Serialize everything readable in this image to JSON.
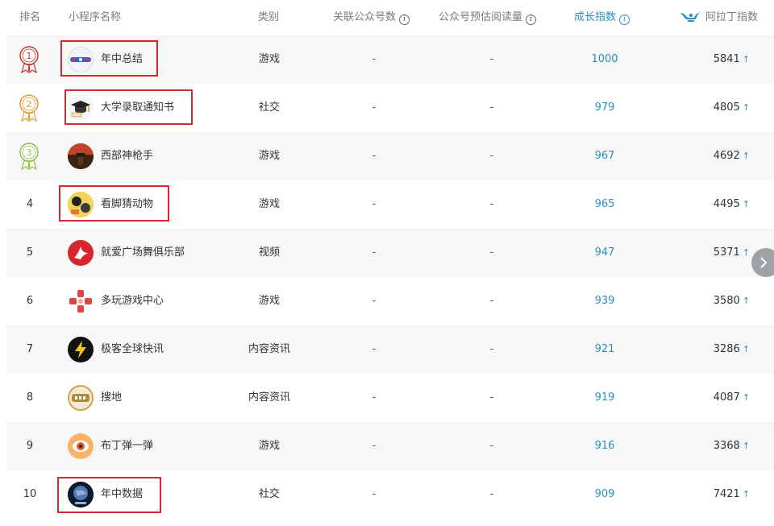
{
  "header": {
    "rank": "排名",
    "name": "小程序名称",
    "category": "类别",
    "linked_accounts": "关联公众号数",
    "estimated_reads": "公众号预估阅读量",
    "growth_index": "成长指数",
    "aladin_index": "阿拉丁指数"
  },
  "rows": [
    {
      "rank": "1",
      "name": "年中总结",
      "category": "游戏",
      "linked": "-",
      "reads": "-",
      "growth": "1000",
      "aladin": "5841",
      "icon": "annual-summary-icon"
    },
    {
      "rank": "2",
      "name": "大学录取通知书",
      "category": "社交",
      "linked": "-",
      "reads": "-",
      "growth": "979",
      "aladin": "4805",
      "icon": "graduation-cap-icon"
    },
    {
      "rank": "3",
      "name": "西部神枪手",
      "category": "游戏",
      "linked": "-",
      "reads": "-",
      "growth": "967",
      "aladin": "4692",
      "icon": "western-gunman-icon"
    },
    {
      "rank": "4",
      "name": "看脚猜动物",
      "category": "游戏",
      "linked": "-",
      "reads": "-",
      "growth": "965",
      "aladin": "4495",
      "icon": "guess-animal-icon"
    },
    {
      "rank": "5",
      "name": "就爱广场舞俱乐部",
      "category": "视频",
      "linked": "-",
      "reads": "-",
      "growth": "947",
      "aladin": "5371",
      "icon": "dancer-icon"
    },
    {
      "rank": "6",
      "name": "多玩游戏中心",
      "category": "游戏",
      "linked": "-",
      "reads": "-",
      "growth": "939",
      "aladin": "3580",
      "icon": "gamepad-icon"
    },
    {
      "rank": "7",
      "name": "极客全球快讯",
      "category": "内容资讯",
      "linked": "-",
      "reads": "-",
      "growth": "921",
      "aladin": "3286",
      "icon": "lightning-icon"
    },
    {
      "rank": "8",
      "name": "搜地",
      "category": "内容资讯",
      "linked": "-",
      "reads": "-",
      "growth": "919",
      "aladin": "4087",
      "icon": "sou-di-icon"
    },
    {
      "rank": "9",
      "name": "布丁弹一弹",
      "category": "游戏",
      "linked": "-",
      "reads": "-",
      "growth": "916",
      "aladin": "3368",
      "icon": "pudding-eye-icon"
    },
    {
      "rank": "10",
      "name": "年中数据",
      "category": "社交",
      "linked": "-",
      "reads": "-",
      "growth": "909",
      "aladin": "7421",
      "icon": "earth-icon"
    }
  ],
  "colors": {
    "accent": "#2a8fbd",
    "highlight_box": "#d9262b",
    "medal_gold": "#c0392b",
    "medal_silver": "#e59a2c",
    "medal_bronze": "#8bc34a"
  },
  "icons": {
    "up_arrow": "↑",
    "next": "chevron-right-icon",
    "info": "i"
  }
}
